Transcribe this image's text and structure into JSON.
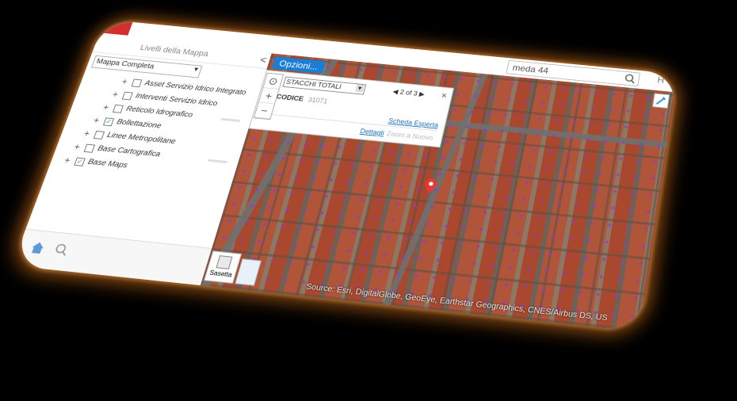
{
  "search": {
    "value": "meda 44",
    "placeholder": ""
  },
  "topbar": {
    "right_label": "H"
  },
  "sidebar": {
    "title": "Livelli della Mappa",
    "collapse": "<",
    "select_value": "Mappa Completa",
    "layers": [
      {
        "label": "Asset Servizio Idrico Integrato",
        "checked": false
      },
      {
        "label": "Interventi Servizio Idrico",
        "checked": false
      },
      {
        "label": "Reticolo Idrografico",
        "checked": false
      },
      {
        "label": "Bollettazione",
        "checked": true
      },
      {
        "label": "Linee Metropolitane",
        "checked": false
      },
      {
        "label": "Base Cartografica",
        "checked": false
      },
      {
        "label": "Base Maps",
        "checked": true
      }
    ]
  },
  "map": {
    "options_label": "Opzioni...",
    "zoom_in": "+",
    "zoom_out": "−",
    "legend_label": "Sasetta",
    "attribution": "Source: Esri, DigitalGlobe, GeoEye, Earthstar Geographics, CNES/Airbus DS, US"
  },
  "popup": {
    "select_value": "STACCHI TOTALI",
    "nav": "2 of 3",
    "close": "×",
    "field_label": "CODICE",
    "field_value": "31071",
    "link_scheda": "Scheda Esperta",
    "link_dettagli": "Dettagli",
    "link_zoom": "Zoom a Nuovo"
  },
  "colors": {
    "accent": "#1a7fd4",
    "brand": "#d32f2f",
    "glow": "#8a4a12"
  }
}
